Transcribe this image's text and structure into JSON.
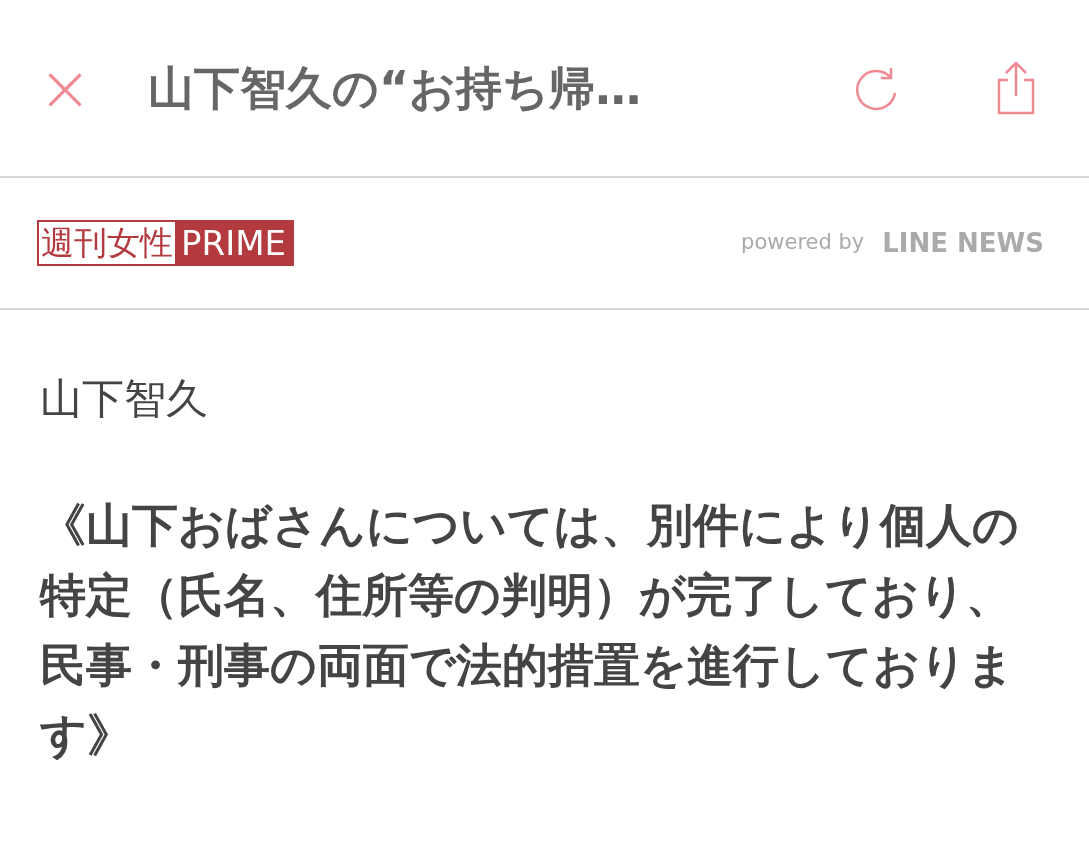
{
  "header": {
    "close": "×",
    "title": "山下智久の“お持ち帰…"
  },
  "source": {
    "logo_left": "週刊女性",
    "logo_right": "PRIME",
    "powered_by": "powered by",
    "provider": "LINE NEWS"
  },
  "article": {
    "author": "山下智久",
    "quote": "《山下おばさんについては、別件により個人の特定（氏名、住所等の判明）が完了しており、民事・刑事の両面で法的措置を進行しております》"
  }
}
